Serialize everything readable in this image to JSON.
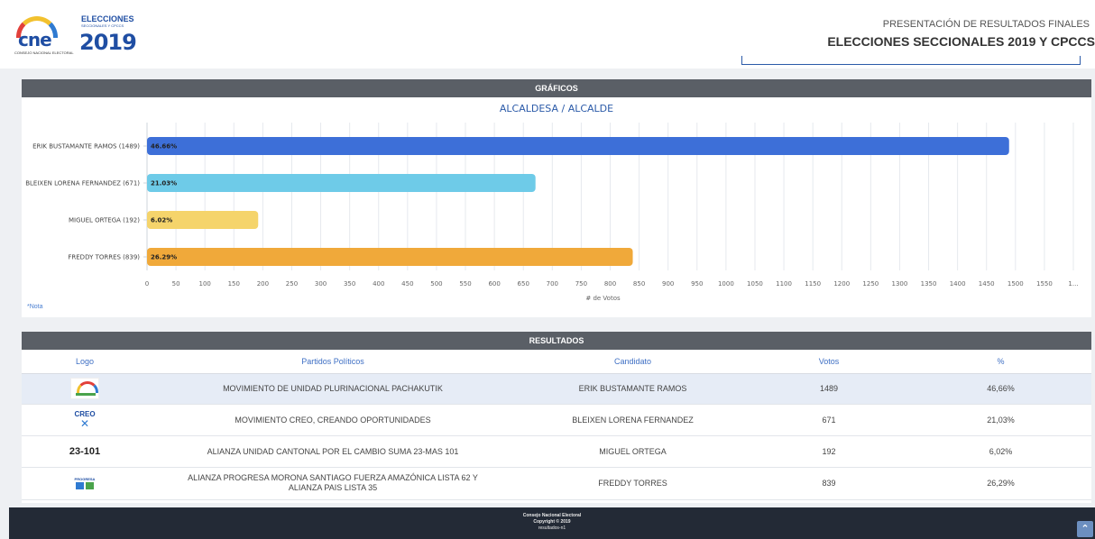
{
  "header": {
    "logo_cne": "cne",
    "logo_cne_sub": "CONSEJO NACIONAL ELECTORAL",
    "logo_elecciones": "ELECCIONES",
    "logo_elecciones_sub": "SECCIONALES Y CPCCS",
    "logo_year": "2019",
    "subtitle": "PRESENTACIÓN DE RESULTADOS FINALES",
    "title": "ELECCIONES SECCIONALES 2019 Y CPCCS"
  },
  "chart_panel": {
    "header": "GRÁFICOS",
    "note": "*Nota"
  },
  "chart_data": {
    "type": "bar",
    "orientation": "horizontal",
    "title": "ALCALDESA / ALCALDE",
    "xlabel": "# de Votos",
    "ylabel": "",
    "categories": [
      "ERIK BUSTAMANTE RAMOS (1489)",
      "BLEIXEN LORENA FERNANDEZ (671)",
      "MIGUEL ORTEGA (192)",
      "FREDDY TORRES (839)"
    ],
    "values": [
      1489,
      671,
      192,
      839
    ],
    "data_labels": [
      "46.66%",
      "21.03%",
      "6.02%",
      "26.29%"
    ],
    "colors": [
      "#3d6fd8",
      "#6ecbe8",
      "#f5d46b",
      "#f0a93a"
    ],
    "xlim": [
      0,
      1600
    ],
    "xticks": [
      "0",
      "50",
      "100",
      "150",
      "200",
      "250",
      "300",
      "350",
      "400",
      "450",
      "500",
      "550",
      "600",
      "650",
      "700",
      "750",
      "800",
      "850",
      "900",
      "950",
      "1000",
      "1050",
      "1100",
      "1150",
      "1200",
      "1250",
      "1300",
      "1350",
      "1400",
      "1450",
      "1500",
      "1550",
      "1..."
    ],
    "grid": true
  },
  "results": {
    "header": "RESULTADOS",
    "columns": [
      "Logo",
      "Partidos Políticos",
      "Candidato",
      "Votos",
      "%"
    ],
    "rows": [
      {
        "logo": "pachakutik-logo",
        "party": "MOVIMIENTO DE UNIDAD PLURINACIONAL PACHAKUTIK",
        "candidate": "ERIK BUSTAMANTE RAMOS",
        "votes": "1489",
        "pct": "46,66%"
      },
      {
        "logo": "creo-logo",
        "logo_text": "CREO",
        "party": "MOVIMIENTO CREO, CREANDO OPORTUNIDADES",
        "candidate": "BLEIXEN LORENA FERNANDEZ",
        "votes": "671",
        "pct": "21,03%"
      },
      {
        "logo": "list-number",
        "logo_text": "23-101",
        "party": "ALIANZA UNIDAD CANTONAL POR EL CAMBIO SUMA 23-MAS 101",
        "candidate": "MIGUEL ORTEGA",
        "votes": "192",
        "pct": "6,02%"
      },
      {
        "logo": "progresa-logo",
        "logo_text": "PROGRESA",
        "party_line1": "ALIANZA PROGRESA MORONA SANTIAGO FUERZA AMAZÓNICA LISTA 62 Y",
        "party_line2": "ALIANZA PAIS LISTA 35",
        "candidate": "FREDDY TORRES",
        "votes": "839",
        "pct": "26,29%"
      }
    ]
  },
  "footer": {
    "line1": "Consejo Nacional Electoral",
    "line2": "Copyright © 2019",
    "line3": "resultados-n1"
  },
  "scroll_top_icon": "chevron-up-icon"
}
